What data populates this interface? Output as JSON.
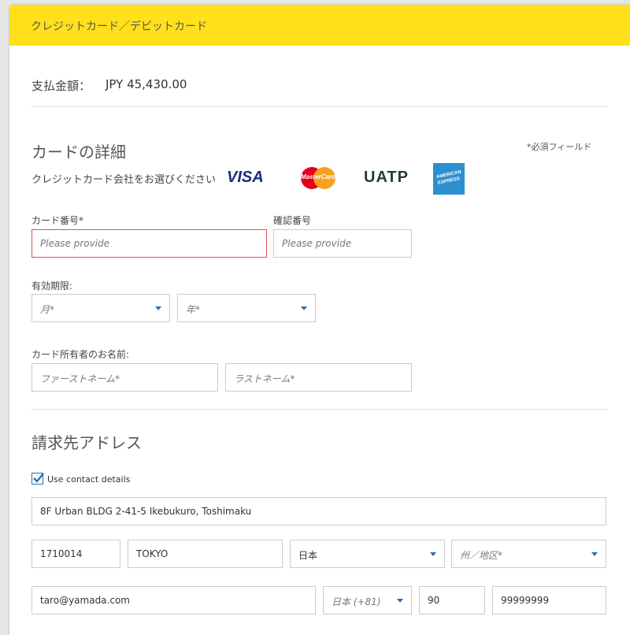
{
  "header": {
    "title": "クレジットカード／デビットカード"
  },
  "payment": {
    "amount_label": "支払金額：",
    "amount_value": "JPY 45,430.00"
  },
  "card_details": {
    "title": "カードの詳細",
    "required_note": "*必須フィールド",
    "select_note": "クレジットカード会社をお選びください",
    "brands": {
      "visa": "VISA",
      "mastercard": "MasterCard",
      "uatp": "UATP",
      "amex_line1": "AMERICAN",
      "amex_line2": "EXPRESS"
    },
    "card_number_label": "カード番号*",
    "card_number_placeholder": "Please provide",
    "cvv_label": "確認番号",
    "cvv_placeholder": "Please provide",
    "expiry_label": "有効期限:",
    "month_placeholder": "月*",
    "year_placeholder": "年*",
    "holder_label": "カード所有者のお名前:",
    "first_name_placeholder": "ファーストネーム*",
    "last_name_placeholder": "ラストネーム*"
  },
  "billing": {
    "title": "請求先アドレス",
    "use_contact_label": "Use contact details",
    "use_contact_checked": true,
    "address": "8F Urban BLDG  2-41-5 Ikebukuro, Toshimaku",
    "postal_code": "1710014",
    "city": "TOKYO",
    "country": "日本",
    "state_placeholder": "州／地区*",
    "email": "taro@yamada.com",
    "phone_country": "日本 (+81)",
    "area_code": "90",
    "phone_number": "99999999"
  },
  "colors": {
    "header": "#ffe01b",
    "error": "#e25050",
    "accent": "#2a6fb0"
  }
}
